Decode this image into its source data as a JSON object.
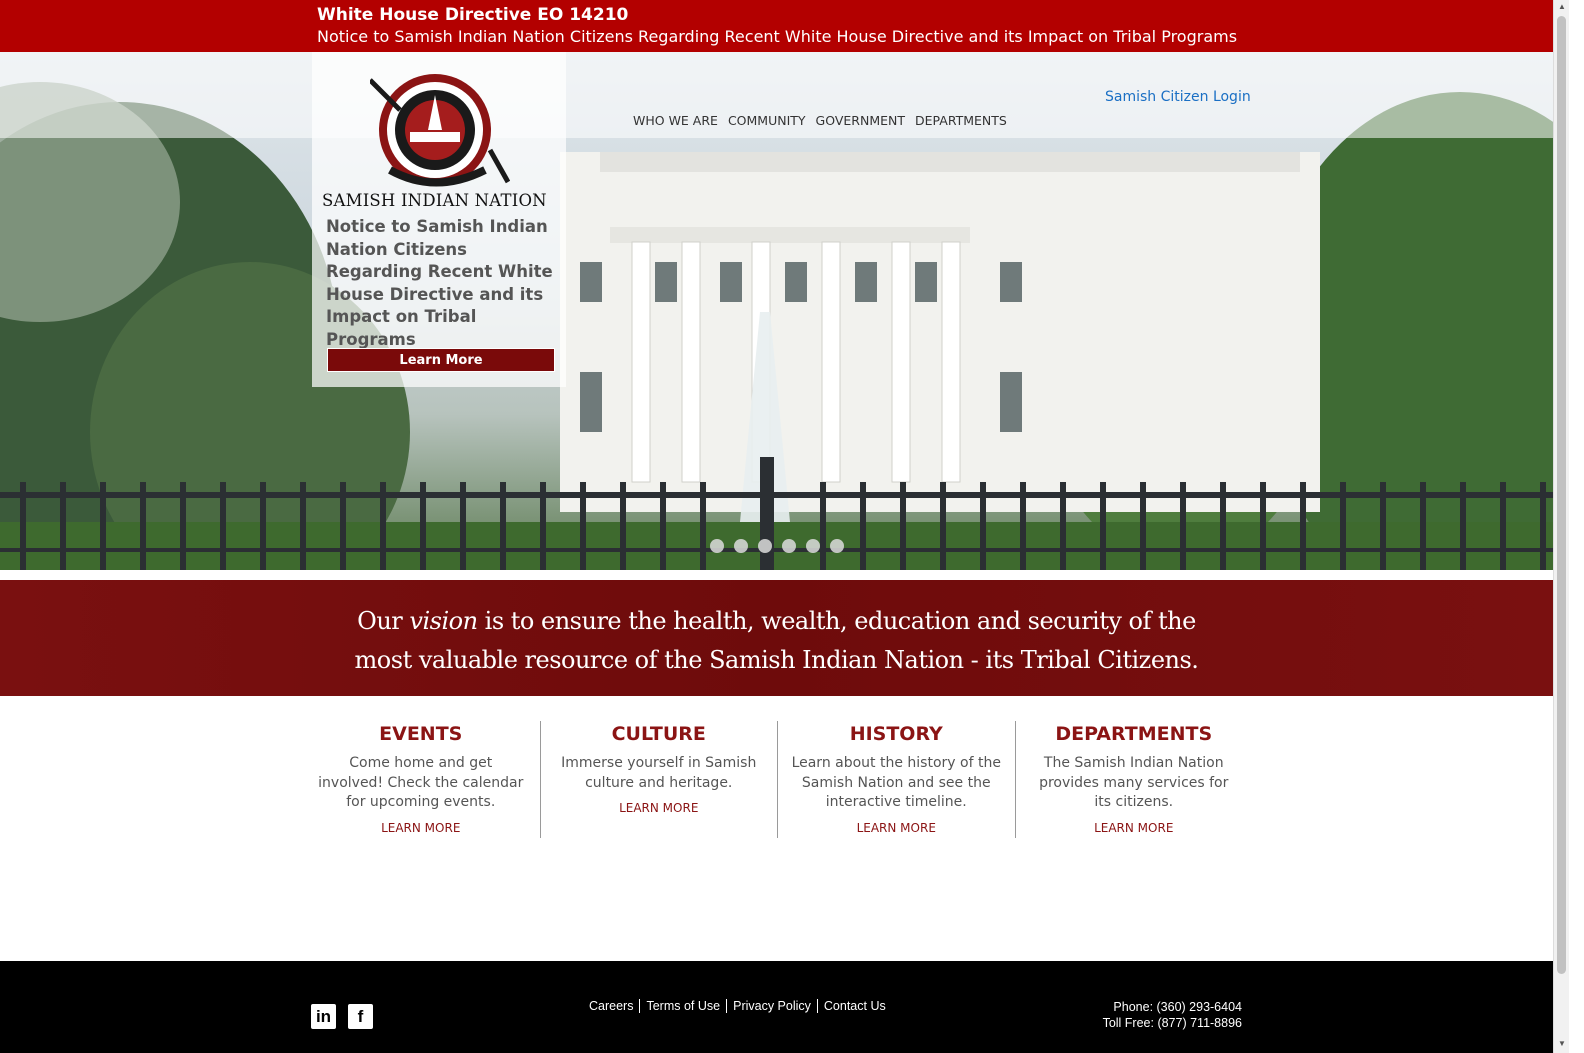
{
  "alert": {
    "title": "White House Directive EO 14210",
    "text": "Notice to Samish Indian Nation Citizens Regarding Recent White House Directive and its Impact on Tribal Programs"
  },
  "brand": {
    "name": "SAMISH INDIAN NATION"
  },
  "nav": {
    "items": [
      "WHO WE ARE",
      "COMMUNITY",
      "GOVERNMENT",
      "DEPARTMENTS"
    ]
  },
  "login": {
    "label": "Samish Citizen Login"
  },
  "slide": {
    "caption": "Notice to Samish Indian Nation Citizens Regarding Recent White House Directive and its Impact on Tribal Programs",
    "button_label": "Learn More",
    "dot_count": 6
  },
  "vision": {
    "prefix": "Our ",
    "emphasis": "vision",
    "line1_rest": " is to ensure the health, wealth, education and security of the",
    "line2": "most valuable resource of the Samish Indian Nation - its Tribal Citizens."
  },
  "features": [
    {
      "title": "EVENTS",
      "desc": "Come home and get involved! Check the calendar for upcoming events.",
      "link": "LEARN MORE"
    },
    {
      "title": "CULTURE",
      "desc": "Immerse yourself in Samish culture and heritage.",
      "link": "LEARN MORE"
    },
    {
      "title": "HISTORY",
      "desc": "Learn about the history of the Samish Nation and see the interactive timeline.",
      "link": "LEARN MORE"
    },
    {
      "title": "DEPARTMENTS",
      "desc": "The Samish Indian Nation provides many services for its citizens.",
      "link": "LEARN MORE"
    }
  ],
  "footer": {
    "social": [
      {
        "icon": "linkedin-icon",
        "glyph": "in"
      },
      {
        "icon": "facebook-icon",
        "glyph": "f"
      }
    ],
    "links": [
      "Careers",
      "Terms of Use",
      "Privacy Policy",
      "Contact Us"
    ],
    "phone": "Phone: (360) 293-6404",
    "tollfree": "Toll Free: (877) 711-8896"
  },
  "colors": {
    "accent": "#b30000",
    "maroon": "#7a0a0a",
    "link_blue": "#1a6fc4"
  }
}
